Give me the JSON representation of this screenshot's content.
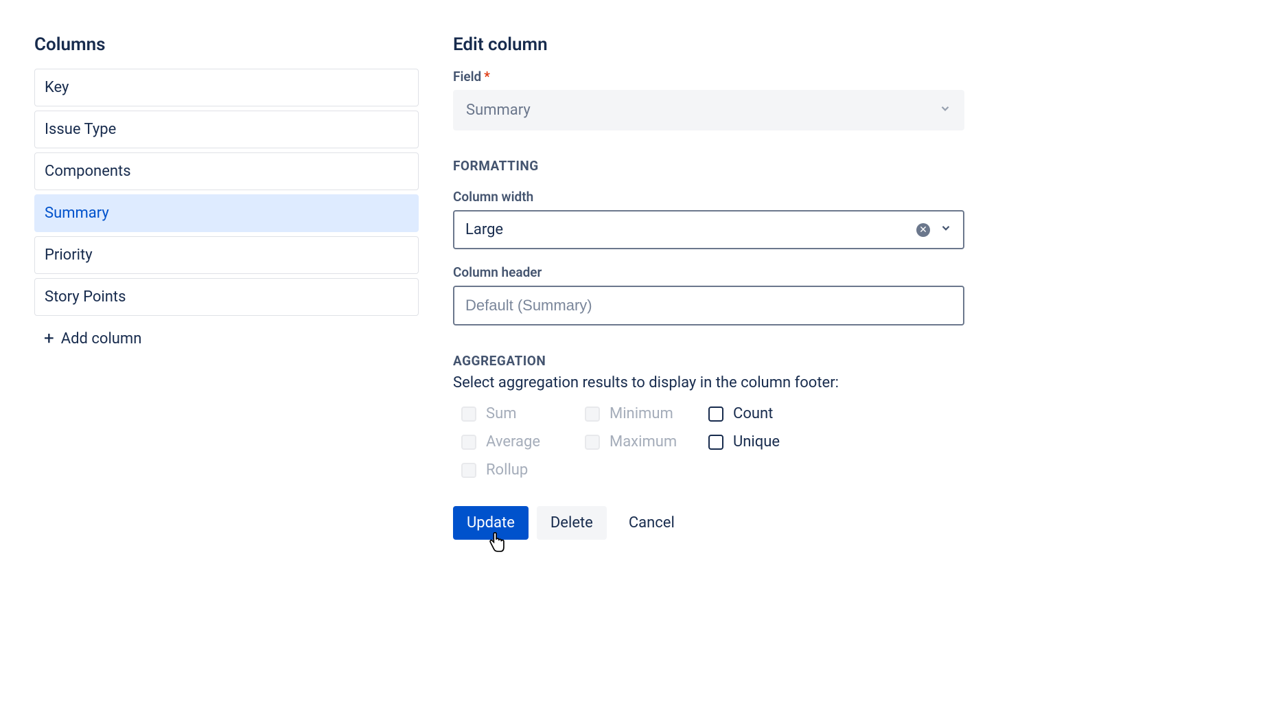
{
  "left": {
    "title": "Columns",
    "items": [
      {
        "label": "Key",
        "selected": false
      },
      {
        "label": "Issue Type",
        "selected": false
      },
      {
        "label": "Components",
        "selected": false
      },
      {
        "label": "Summary",
        "selected": true
      },
      {
        "label": "Priority",
        "selected": false
      },
      {
        "label": "Story Points",
        "selected": false
      }
    ],
    "add_label": "Add column"
  },
  "right": {
    "title": "Edit column",
    "field_label": "Field",
    "field_value": "Summary",
    "formatting_section": "FORMATTING",
    "width_label": "Column width",
    "width_value": "Large",
    "header_label": "Column header",
    "header_placeholder": "Default (Summary)",
    "aggregation_section": "AGGREGATION",
    "aggregation_desc": "Select aggregation results to display in the column footer:",
    "agg": {
      "sum": "Sum",
      "average": "Average",
      "rollup": "Rollup",
      "minimum": "Minimum",
      "maximum": "Maximum",
      "count": "Count",
      "unique": "Unique"
    },
    "buttons": {
      "update": "Update",
      "delete": "Delete",
      "cancel": "Cancel"
    }
  }
}
